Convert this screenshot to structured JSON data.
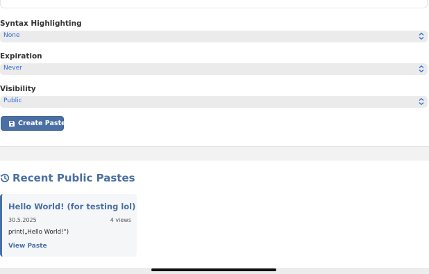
{
  "form": {
    "syntax": {
      "label": "Syntax Highlighting",
      "value": "None"
    },
    "expiration": {
      "label": "Expiration",
      "value": "Never"
    },
    "visibility": {
      "label": "Visibility",
      "value": "Public"
    },
    "submit_label": "Create Paste"
  },
  "recent": {
    "title": "Recent Public Pastes",
    "pastes": [
      {
        "title": "Hello World! (for testing lol)",
        "date": "30.5.2025",
        "views": "4 views",
        "preview": "print(„Hello World!“)",
        "link_label": "View Paste"
      }
    ]
  },
  "icons": {
    "select_chevron": "chevron-up-down-icon",
    "save": "floppy-disk-icon",
    "history": "history-icon"
  },
  "colors": {
    "accent": "#4a6fa5",
    "select_text": "#2f6bd8",
    "select_bg": "#ebebeb"
  }
}
